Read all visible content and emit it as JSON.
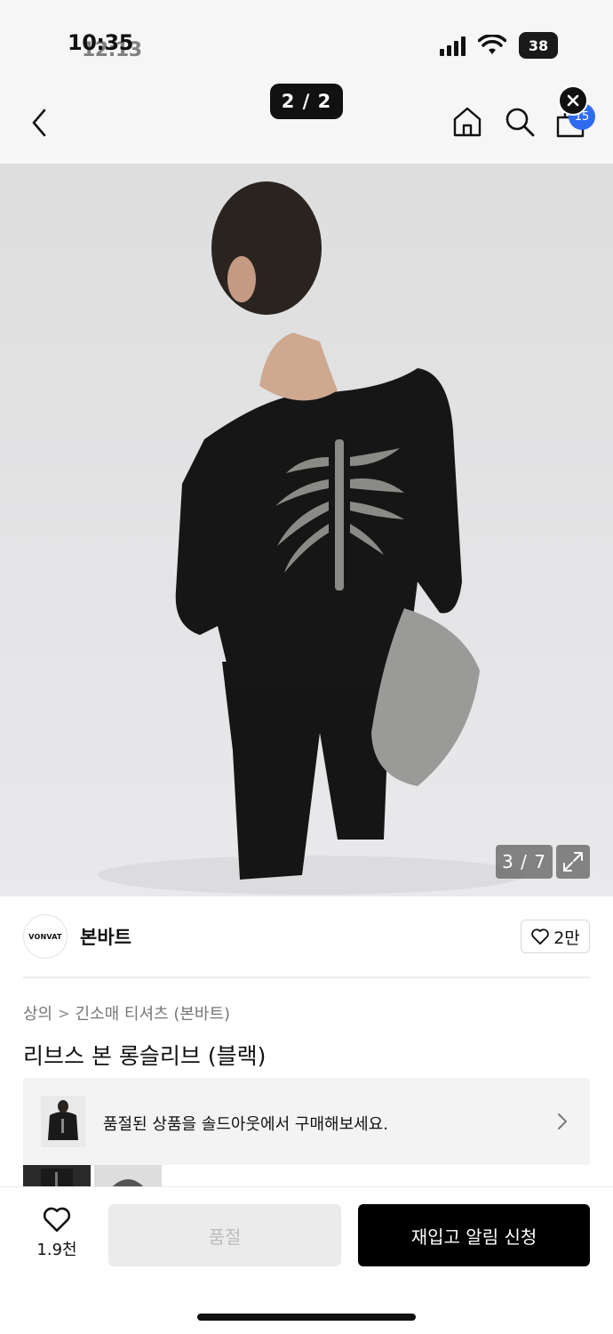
{
  "status_bar": {
    "time": "10:35",
    "time_overlay": "12:13",
    "battery": "38"
  },
  "nav": {
    "page_indicator": "2 / 2",
    "cart_count": "15"
  },
  "gallery": {
    "counter": "3 / 7",
    "background_color": "#e4e4e6"
  },
  "brand": {
    "logo_text": "VONVAT",
    "name": "본바트",
    "like_count": "2만"
  },
  "product": {
    "breadcrumb": [
      "상의",
      "긴소매 티셔츠 (본바트)"
    ],
    "title": "리브스 본 롱슬리브 (블랙)"
  },
  "soldout_banner": {
    "text": "품절된 상품을 솔드아웃에서 구매해보세요."
  },
  "bottom_bar": {
    "wish_count": "1.9천",
    "soldout_label": "품절",
    "restock_label": "재입고 알림 신청"
  },
  "colors": {
    "accent_badge": "#2f6bf0",
    "primary_button": "#000000",
    "disabled_button": "#ebebeb"
  }
}
